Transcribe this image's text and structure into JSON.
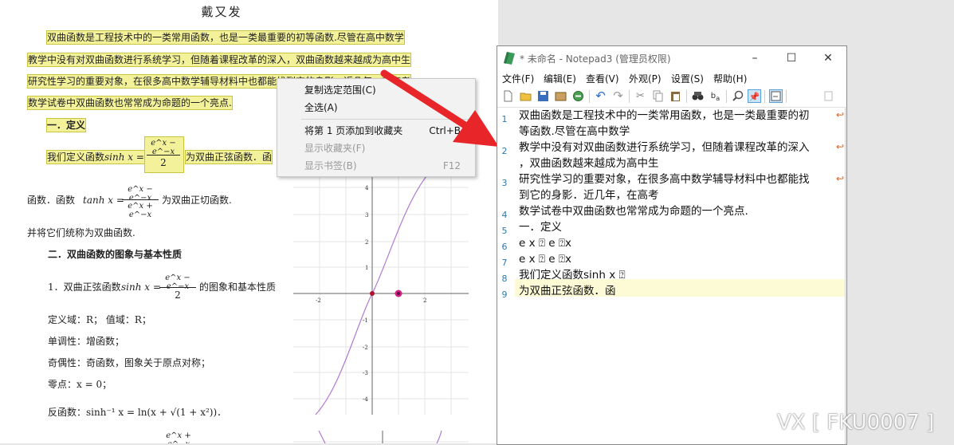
{
  "document": {
    "author": "戴又发",
    "para_lines": [
      "双曲函数是工程技术中的一类常用函数，也是一类最重要的初等函数.尽管在高中数学",
      "教学中没有对双曲函数进行系统学习，但随着课程改革的深入，双曲函数越来越成为高中生",
      "研究性学习的重要对象，在很多高中数学辅导材料中也都能找到它的身影．近几年，在高考",
      "数学试卷中双曲函数也常常成为命题的一个亮点."
    ],
    "section1": "一．定义",
    "def_prefix": "我们定义函数",
    "def_func": "sinh x =",
    "def_num": "e^x − e^−x",
    "def_den": "2",
    "def_suffix": "为双曲正弦函数．函",
    "tanh_prefix": "函数．函数",
    "tanh_func": "tanh x =",
    "tanh_num": "e^x − e^−x",
    "tanh_den": "e^x + e^−x",
    "tanh_suffix": "为双曲正切函数.",
    "unify": "并将它们统称为双曲函数.",
    "section2": "二．双曲函数的图象与基本性质",
    "item1_prefix": "1．双曲正弦函数",
    "item1_func": "sinh x =",
    "item1_num": "e^x − e^−x",
    "item1_den": "2",
    "item1_suffix": "的图象和基本性质",
    "domain_line": "定义域：R；        值域：R；",
    "mono": "单调性：增函数；",
    "parity": "奇偶性：奇函数，图象关于原点对称；",
    "zero": "零点：x = 0；",
    "inverse": "反函数：sinh⁻¹ x = ln(x + √(1 + x²))．",
    "bottom_frac": "e^x + e^−x"
  },
  "graph": {
    "y_ticks": [
      "4",
      "3",
      "2",
      "1",
      "-1",
      "-2",
      "-3",
      "-4"
    ],
    "x_ticks": [
      "-2",
      "2"
    ],
    "curve_color": "#b07ad0",
    "point_color": "#b01030",
    "pink_point_color": "#d0208a"
  },
  "context_menu": {
    "items": [
      {
        "label": "复制选定范围(C)",
        "shortcut": "",
        "enabled": true
      },
      {
        "label": "全选(A)",
        "shortcut": "",
        "enabled": true
      },
      {
        "label": "将第 1 页添加到收藏夹",
        "shortcut": "Ctrl+B",
        "enabled": true
      },
      {
        "label": "显示收藏夹(F)",
        "shortcut": "",
        "enabled": false
      },
      {
        "label": "显示书签(B)",
        "shortcut": "F12",
        "enabled": false
      }
    ]
  },
  "notepad": {
    "title": "* 未命名 - Notepad3  (管理员权限)",
    "menus": [
      "文件(F)",
      "编辑(E)",
      "查看(V)",
      "外观(P)",
      "设置(S)",
      "帮助(H)"
    ],
    "window_buttons": [
      "–",
      "☐",
      "✕"
    ],
    "lines": [
      {
        "num": "1",
        "text": [
          "双曲函数是工程技术中的一类常用函数，也是一类最重要的初",
          "等函数.尽管在高中数学"
        ]
      },
      {
        "num": "2",
        "text": [
          "教学中没有对双曲函数进行系统学习，但随着课程改革的深入",
          "，双曲函数越来越成为高中生"
        ]
      },
      {
        "num": "3",
        "text": [
          "研究性学习的重要对象，在很多高中数学辅导材料中也都能找",
          "到它的身影．近几年，在高考"
        ]
      },
      {
        "num": "4",
        "text": [
          "数学试卷中双曲函数也常常成为命题的一个亮点."
        ]
      },
      {
        "num": "5",
        "text": [
          "一．定义"
        ]
      },
      {
        "num": "6",
        "text": [
          "e x \u0000 e \u0000x"
        ]
      },
      {
        "num": "7",
        "text": [
          "e x \u0000 e \u0000x"
        ]
      },
      {
        "num": "8",
        "text": [
          "我们定义函数sinh x \u0000"
        ]
      },
      {
        "num": "9",
        "text": [
          "为双曲正弦函数．函"
        ]
      }
    ],
    "display_lines": {
      "l6": "e x ⍰ e ⍰x",
      "l7": "e x ⍰ e ⍰x",
      "l8": "我们定义函数sinh x ⍰"
    }
  },
  "annotation": {
    "arrow_color": "#e8262a"
  },
  "watermark": "VX [ FKU0007 ]"
}
